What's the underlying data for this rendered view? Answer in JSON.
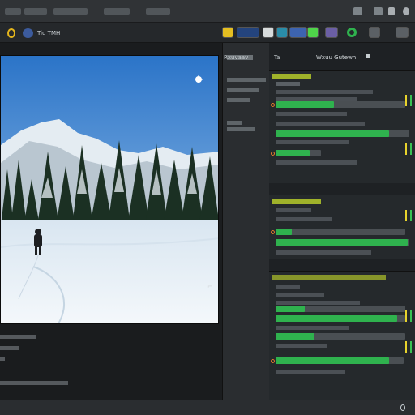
{
  "toolbar": {
    "title": "Tiu TMH"
  },
  "panels": {
    "header_left": "Rxuvaav",
    "header_mid": "Ta",
    "header_right": "Wxuu Gutewn"
  },
  "colors": {
    "accent_green": "#2fb24e",
    "accent_yellow": "#d6e04a",
    "accent_orange": "#e27a2a",
    "background": "#1b1d1f"
  },
  "icons": [
    "minimize-icon",
    "window-icon",
    "user-icon",
    "gear-icon",
    "search-icon",
    "cursor-icon"
  ]
}
